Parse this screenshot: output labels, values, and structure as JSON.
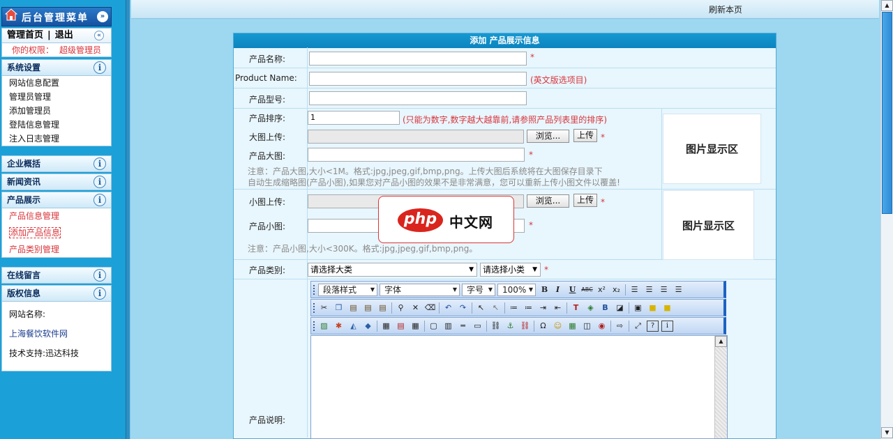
{
  "sidebar": {
    "logo_title": "后台管理菜单",
    "home_link": "管理首页",
    "separator": "|",
    "logout_link": "退出",
    "permission_label": "你的权限：",
    "permission_value": "超级管理员",
    "sections": [
      {
        "title": "系统设置",
        "items": [
          "网站信息配置",
          "管理员管理",
          "添加管理员",
          "登陆信息管理",
          "注入日志管理"
        ]
      },
      {
        "title": "企业概括"
      },
      {
        "title": "新闻资讯"
      },
      {
        "title": "产品展示",
        "items": [
          "产品信息管理",
          "添加产品信息",
          "产品类别管理"
        ]
      },
      {
        "title": "在线留言"
      },
      {
        "title": "版权信息",
        "items": [
          "网站名称:",
          "上海餐饮软件网",
          "技术支持:迅达科技"
        ]
      }
    ],
    "info_glyph": "i",
    "collapse_glyph": "«",
    "menu_toggle_glyph": "»"
  },
  "topbar": {
    "refresh": "刷新本页"
  },
  "form": {
    "title": "添加 产品展示信息",
    "name_label": "产品名称:",
    "en_name_label": "Product Name:",
    "en_name_hint": "(英文版选项目)",
    "model_label": "产品型号:",
    "order_label": "产品排序:",
    "order_value": "1",
    "order_hint": "(只能为数字,数字越大越靠前,请参照产品列表里的排序)",
    "bigimg_upload_label": "大图上传:",
    "bigimg_label": "产品大图:",
    "big_note_line1": "注意：产品大图,大小<1M。格式:jpg,jpeg,gif,bmp,png。上传大图后系统将在大图保存目录下",
    "big_note_line2": "自动生成缩略图(产品小图),如果您对产品小图的效果不是非常满意，您可以重新上传小图文件以覆盖!",
    "smallimg_upload_label": "小图上传:",
    "smallimg_label": "产品小图:",
    "small_note": "注意：产品小图,大小<300K。格式:jpg,jpeg,gif,bmp,png。",
    "browse_label": "浏览...",
    "upload_label": "上传",
    "preview_text": "图片显示区",
    "category_label": "产品类别:",
    "category_main": "请选择大类",
    "category_sub": "请选择小类",
    "desc_label": "产品说明:",
    "required_mark": "*"
  },
  "editor": {
    "paragraph_style": "段落样式",
    "font": "字体",
    "size": "字号",
    "zoom": "100%"
  },
  "overlay": {
    "brand": "php",
    "brand_text": "中文网"
  },
  "colors": {
    "header_blue": "#0c84bf",
    "required_red": "#d8343a",
    "sidebar_blue": "#1ca0d8"
  }
}
